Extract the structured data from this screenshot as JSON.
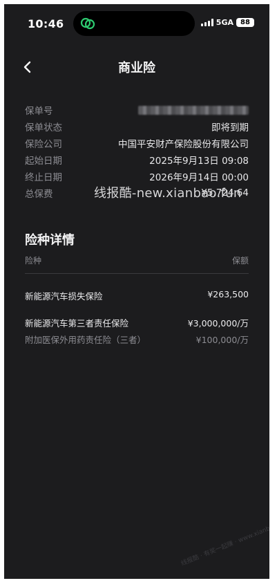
{
  "status_bar": {
    "time": "10:46",
    "network": "5GA",
    "battery": "88"
  },
  "nav": {
    "title": "商业险"
  },
  "policy": {
    "fields": [
      {
        "key": "policy_no",
        "label": "保单号",
        "value": ""
      },
      {
        "key": "status",
        "label": "保单状态",
        "value": "即将到期"
      },
      {
        "key": "insurer",
        "label": "保险公司",
        "value": "中国平安财产保险股份有限公司"
      },
      {
        "key": "start",
        "label": "起始日期",
        "value": "2025年9月13日 09:08"
      },
      {
        "key": "end",
        "label": "终止日期",
        "value": "2026年9月14日 00:00"
      },
      {
        "key": "premium",
        "label": "总保费",
        "value": "¥5,724.64"
      }
    ]
  },
  "watermark": {
    "text": "线报酷-new.xianbao.fun",
    "bottom_text": "线报酷 · 有奖一起赚 · www.xianbao.com"
  },
  "coverage": {
    "title": "险种详情",
    "header": {
      "name": "险种",
      "amount": "保额"
    },
    "items": [
      {
        "name": "新能源汽车损失保险",
        "amount": "¥263,500"
      },
      {
        "name": "新能源汽车第三者责任保险",
        "amount": "¥3,000,000/万"
      },
      {
        "name": "附加医保外用药责任险（三者）",
        "amount": "¥100,000/万"
      }
    ]
  },
  "colors": {
    "background": "#1c1c1e",
    "primary_text": "#e9e9ea",
    "secondary_text": "#8d8d93",
    "app_icon": "#2ecc71"
  },
  "icons": {
    "back": "chevron-left-icon",
    "app": "wechat-link-icon"
  }
}
